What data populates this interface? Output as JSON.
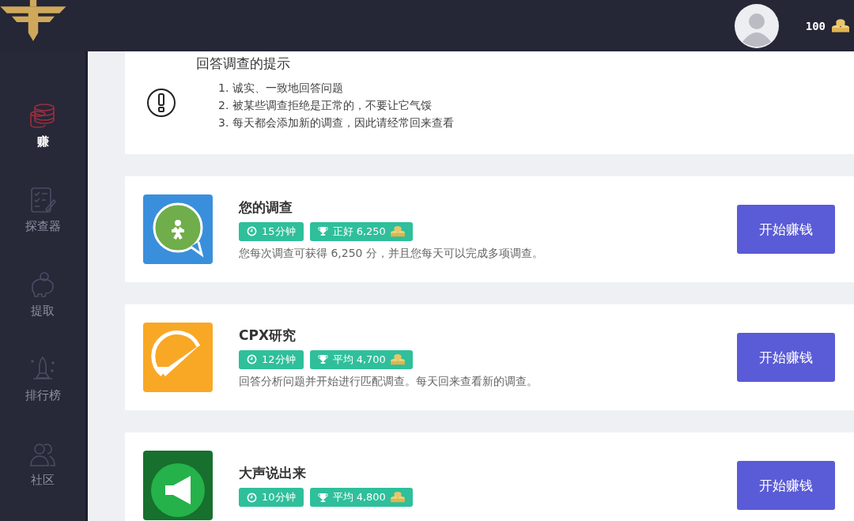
{
  "header": {
    "balance": "100"
  },
  "sidebar": {
    "items": [
      {
        "label": "赚",
        "kind": "coins",
        "selected": true
      },
      {
        "label": "探查器",
        "kind": "checklist",
        "selected": false
      },
      {
        "label": "提取",
        "kind": "piggy",
        "selected": false
      },
      {
        "label": "排行榜",
        "kind": "rocket",
        "selected": false
      },
      {
        "label": "社区",
        "kind": "people",
        "selected": false
      }
    ]
  },
  "tips": {
    "title": "回答调查的提示",
    "items": [
      "1. 诚实、一致地回答问题",
      "2. 被某些调查拒绝是正常的，不要让它气馁",
      "3. 每天都会添加新的调查，因此请经常回来查看"
    ]
  },
  "surveys": [
    {
      "kind": "globe",
      "title": "您的调查",
      "duration": "15分钟",
      "reward": "正好 6,250",
      "description": "您每次调查可获得 6,250 分，并且您每天可以完成多项调查。",
      "button": "开始赚钱"
    },
    {
      "kind": "check",
      "title": "CPX研究",
      "duration": "12分钟",
      "reward": "平均 4,700",
      "description": "回答分析问题并开始进行匹配调查。每天回来查看新的调查。",
      "button": "开始赚钱"
    },
    {
      "kind": "megaphone",
      "title": "大声说出来",
      "duration": "10分钟",
      "reward": "平均 4,800",
      "button": "开始赚钱"
    }
  ]
}
